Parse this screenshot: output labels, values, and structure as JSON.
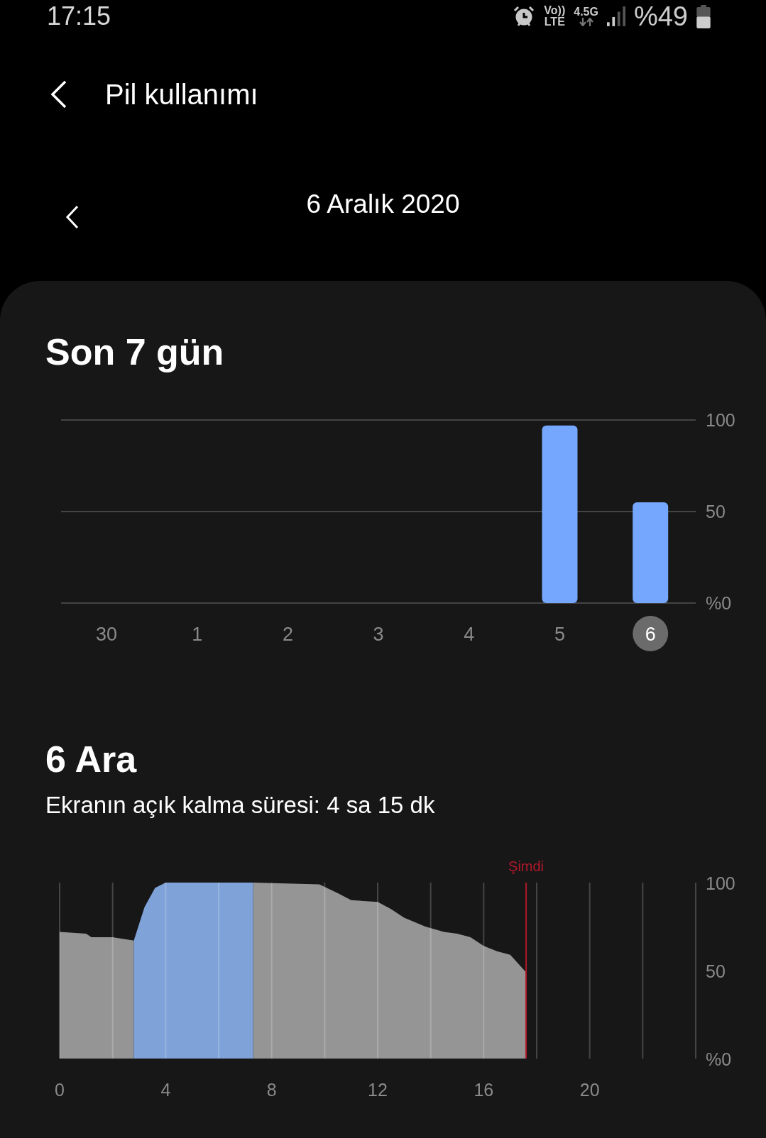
{
  "status_bar": {
    "time": "17:15",
    "volte": "Vo))",
    "lte": "LTE",
    "network": "4.5G",
    "battery": "%49"
  },
  "header": {
    "title": "Pil kullanımı"
  },
  "date_nav": {
    "date": "6 Aralık 2020"
  },
  "weekly": {
    "title": "Son 7 gün",
    "chart_data": {
      "type": "bar",
      "categories": [
        "30",
        "1",
        "2",
        "3",
        "4",
        "5",
        "6"
      ],
      "series": [
        {
          "color": "#76a7ff",
          "values": [
            null,
            null,
            null,
            null,
            null,
            97,
            55
          ]
        }
      ],
      "ylim": [
        0,
        100
      ],
      "yticks": [
        {
          "value": 0,
          "label": "%0"
        },
        {
          "value": 50,
          "label": "50"
        },
        {
          "value": 100,
          "label": "100"
        }
      ]
    },
    "day_states": [
      {
        "selected": false
      },
      {
        "selected": false
      },
      {
        "selected": false
      },
      {
        "selected": false
      },
      {
        "selected": false
      },
      {
        "selected": false
      },
      {
        "selected": true
      }
    ]
  },
  "daily": {
    "title": "6 Ara",
    "subtitle": "Ekranın açık kalma süresi: 4 sa 15 dk",
    "chart_data": {
      "type": "area",
      "x": [
        0,
        1,
        1.2,
        2,
        2.8,
        3.2,
        3.6,
        4,
        7.3,
        9.8,
        10.5,
        11,
        12,
        12.5,
        13,
        13.8,
        14.5,
        15,
        15.5,
        16,
        16.5,
        17,
        17.6
      ],
      "series": [
        {
          "color": "#959595",
          "values": [
            72,
            71,
            69,
            69,
            67,
            null,
            null,
            null,
            100,
            99,
            94,
            90,
            89,
            85,
            80,
            75,
            72,
            71,
            69,
            64,
            61,
            59,
            49
          ]
        },
        {
          "color": "#7fa2d9",
          "values": [
            null,
            null,
            null,
            null,
            67,
            86,
            97,
            100,
            100,
            null,
            null,
            null,
            null,
            null,
            null,
            null,
            null,
            null,
            null,
            null,
            null,
            null,
            null
          ]
        }
      ],
      "xlim": [
        0,
        24
      ],
      "ylim": [
        0,
        100
      ],
      "xticks": [
        0,
        4,
        8,
        12,
        16,
        20
      ],
      "yticks": [
        {
          "value": 0,
          "label": "%0"
        },
        {
          "value": 50,
          "label": "50"
        },
        {
          "value": 100,
          "label": "100"
        }
      ],
      "grid": true,
      "ref_lines": [
        {
          "axis": "x",
          "value": 17.6,
          "label": "Şimdi",
          "color": "#b0182a"
        }
      ]
    }
  }
}
